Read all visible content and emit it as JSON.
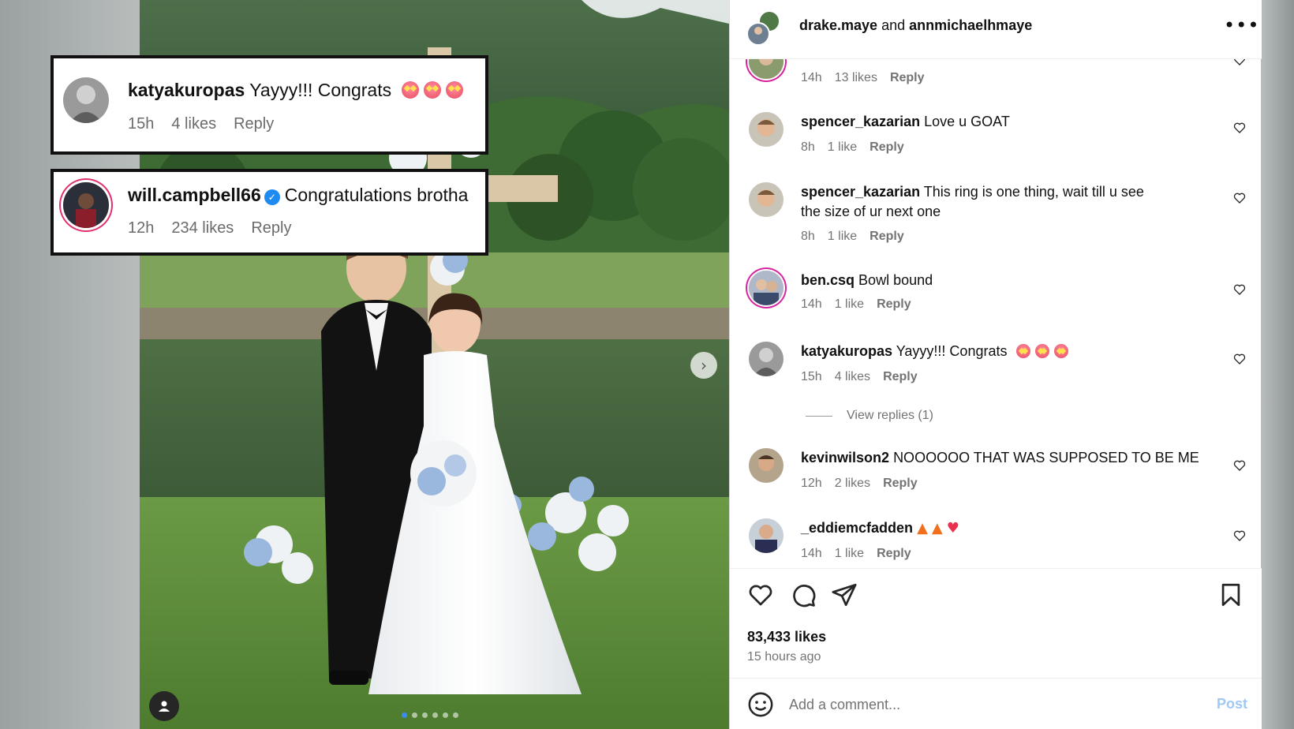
{
  "post": {
    "header_user_1": "drake.maye",
    "header_and": "and",
    "header_user_2": "annmichaelhmaye",
    "more_icon": "more-horizontal-icon",
    "likes": "83,433 likes",
    "time_ago": "15 hours ago",
    "add_comment_placeholder": "Add a comment...",
    "post_label": "Post",
    "view_replies": "View replies (1)"
  },
  "callouts": [
    {
      "user": "katyakuropas",
      "text": "Yayyy!!! Congrats",
      "time": "15h",
      "likes": "4 likes",
      "reply": "Reply",
      "emoji_count": 3
    },
    {
      "user": "will.campbell66",
      "text": "Congratulations brotha",
      "time": "12h",
      "likes": "234 likes",
      "reply": "Reply",
      "verified": true
    }
  ],
  "comments": [
    {
      "user": "",
      "text": "",
      "time": "14h",
      "likes": "13 likes",
      "reply": "Reply"
    },
    {
      "user": "spencer_kazarian",
      "text": "Love u GOAT",
      "time": "8h",
      "likes": "1 like",
      "reply": "Reply"
    },
    {
      "user": "spencer_kazarian",
      "text": "This ring is one thing, wait till u see the size of ur next one",
      "time": "8h",
      "likes": "1 like",
      "reply": "Reply"
    },
    {
      "user": "ben.csq",
      "text": "Bowl bound",
      "time": "14h",
      "likes": "1 like",
      "reply": "Reply"
    },
    {
      "user": "katyakuropas",
      "text": "Yayyy!!! Congrats",
      "time": "15h",
      "likes": "4 likes",
      "reply": "Reply"
    },
    {
      "user": "kevinwilson2",
      "text": "NOOOOOO THAT WAS SUPPOSED TO BE ME",
      "time": "12h",
      "likes": "2 likes",
      "reply": "Reply"
    },
    {
      "user": "_eddiemcfadden",
      "text": "",
      "time": "14h",
      "likes": "1 like",
      "reply": "Reply"
    }
  ],
  "icons": {
    "like": "heart-icon",
    "comment": "comment-bubble-icon",
    "share": "paper-plane-icon",
    "save": "bookmark-icon",
    "emoji": "smiley-icon",
    "next": "chevron-right-icon",
    "tags": "user-tag-icon"
  },
  "colors": {
    "post_button": "#9ec9f5",
    "verified": "#1f8bf0",
    "story_ring": "#d6249f",
    "carousel_active_dot": "#3b8cf0"
  }
}
